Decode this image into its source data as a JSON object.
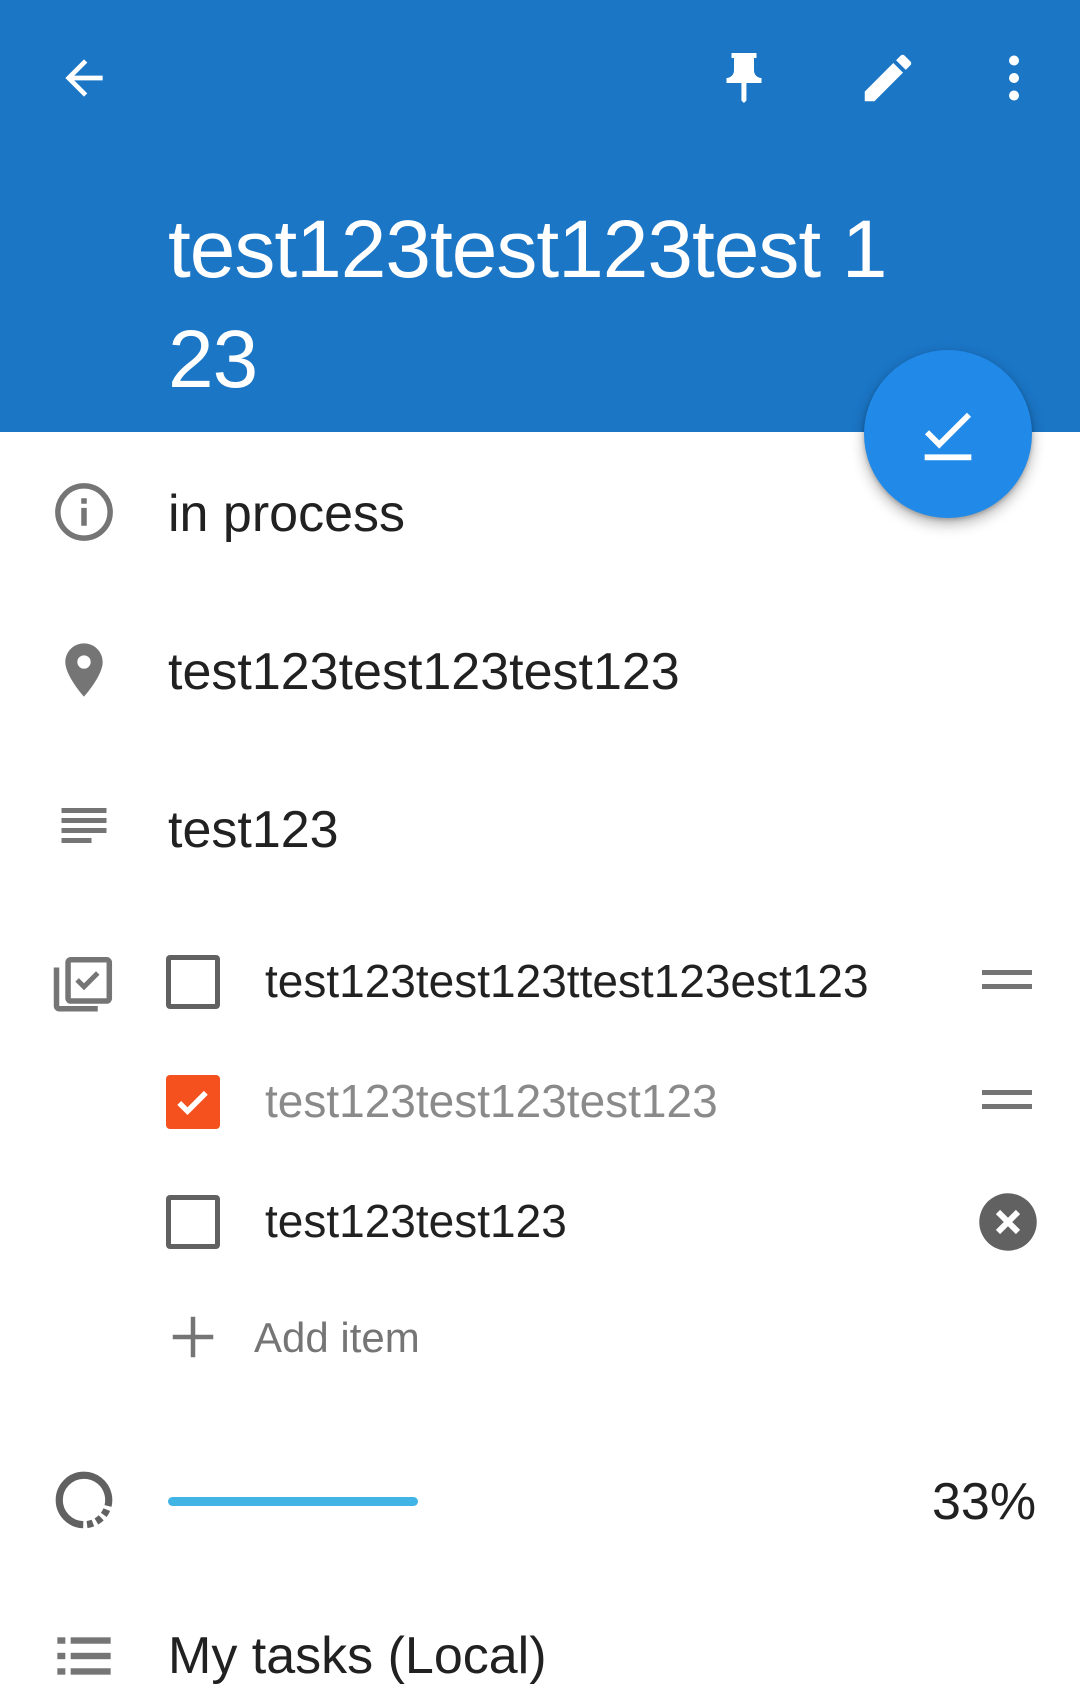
{
  "appbar": {
    "color": "#1B76C6",
    "back_icon": "arrow-back-icon",
    "pin_icon": "pin-icon",
    "edit_icon": "pencil-icon",
    "more_icon": "more-vert-icon"
  },
  "task": {
    "title": "test123test123test 123",
    "status": "in process",
    "location": "test123test123test123",
    "description": "test123"
  },
  "fab": {
    "icon": "check-done-icon",
    "color": "#2189E8"
  },
  "checklist": {
    "items": [
      {
        "label": "test123test123ttest123est123",
        "checked": false
      },
      {
        "label": "test123test123test123",
        "checked": true
      },
      {
        "label": "test123test123",
        "checked": false
      }
    ],
    "add_label": "Add item",
    "checked_color": "#F4511E"
  },
  "progress": {
    "value": 0.33,
    "label": "33%",
    "color": "#40B4E5"
  },
  "list": {
    "label": "My tasks (Local)"
  }
}
